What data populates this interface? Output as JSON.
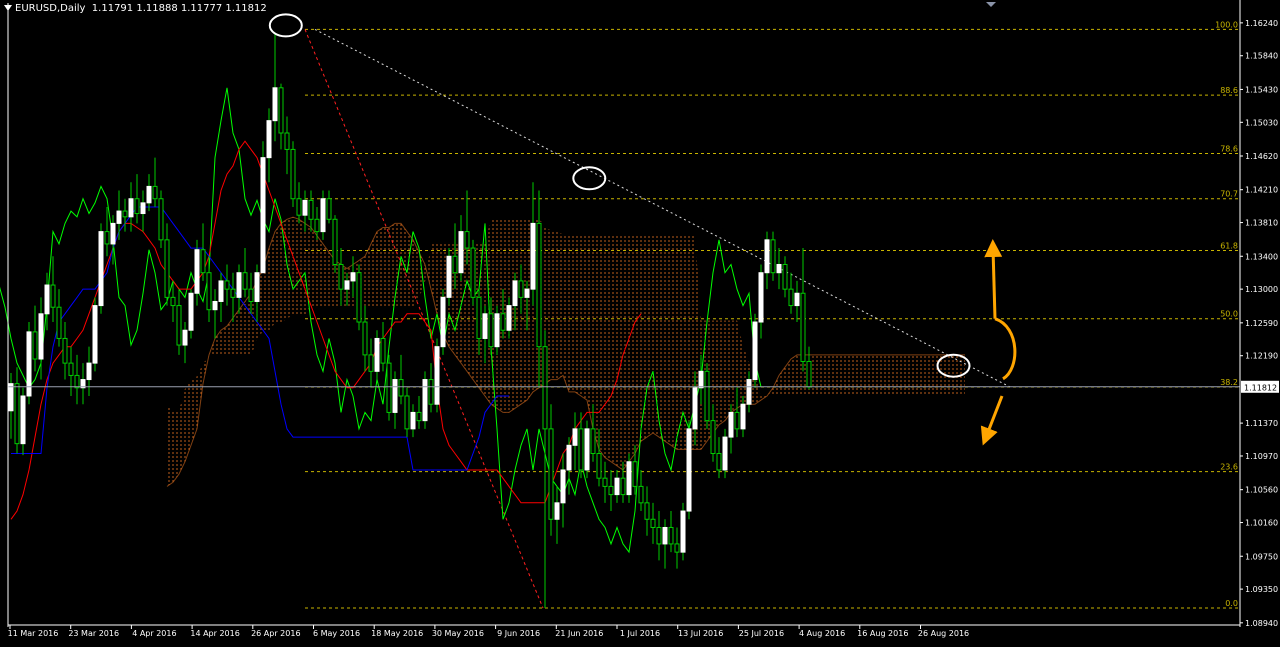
{
  "header": {
    "symbol": "EURUSD,Daily",
    "quote": "1.11791 1.11888 1.11777 1.11812"
  },
  "colors": {
    "background": "#000000",
    "axis": "#ffffff",
    "bull": "#ffffff",
    "bear": "#00cc00",
    "tenkan": "#ff0000",
    "kijun": "#0000ff",
    "chikou": "#00ff00",
    "cloud": "#d2691e",
    "fib": "#c8b400",
    "annotation": "#ffa500"
  },
  "chart_data": {
    "type": "candlestick",
    "ylim": [
      1.0895,
      1.1636
    ],
    "price_axis_ticks": [
      "1.16240",
      "1.15840",
      "1.15430",
      "1.15030",
      "1.14620",
      "1.14210",
      "1.13810",
      "1.13400",
      "1.13000",
      "1.12590",
      "1.12190",
      "1.11812",
      "1.11370",
      "1.10970",
      "1.10560",
      "1.10160",
      "1.09750",
      "1.09350",
      "1.08940"
    ],
    "current_price": 1.11812,
    "date_labels": [
      "11 Mar 2016",
      "23 Mar 2016",
      "4 Apr 2016",
      "14 Apr 2016",
      "26 Apr 2016",
      "6 May 2016",
      "18 May 2016",
      "30 May 2016",
      "9 Jun 2016",
      "21 Jun 2016",
      "1 Jul 2016",
      "13 Jul 2016",
      "25 Jul 2016",
      "4 Aug 2016",
      "16 Aug 2016",
      "26 Aug 2016"
    ],
    "fibonacci": {
      "high": 1.1616,
      "low": 1.0912,
      "levels": [
        {
          "label": "100.0",
          "value": 1.1616
        },
        {
          "label": "88.6",
          "value": 1.1536
        },
        {
          "label": "78.6",
          "value": 1.1465
        },
        {
          "label": "70.7",
          "value": 1.141
        },
        {
          "label": "61.8",
          "value": 1.1347
        },
        {
          "label": "50.0",
          "value": 1.1264
        },
        {
          "label": "38.2",
          "value": 1.1181
        },
        {
          "label": "23.6",
          "value": 1.1078
        },
        {
          "label": "0.0",
          "value": 1.0912
        }
      ]
    },
    "candles": [
      [
        1.1152,
        1.1198,
        1.1118,
        1.1185
      ],
      [
        1.1185,
        1.1205,
        1.11,
        1.1112
      ],
      [
        1.1112,
        1.118,
        1.1098,
        1.117
      ],
      [
        1.117,
        1.126,
        1.116,
        1.1248
      ],
      [
        1.1248,
        1.128,
        1.12,
        1.1215
      ],
      [
        1.1215,
        1.129,
        1.119,
        1.127
      ],
      [
        1.127,
        1.132,
        1.125,
        1.1305
      ],
      [
        1.1305,
        1.134,
        1.126,
        1.1278
      ],
      [
        1.1278,
        1.13,
        1.123,
        1.124
      ],
      [
        1.124,
        1.126,
        1.119,
        1.121
      ],
      [
        1.121,
        1.123,
        1.117,
        1.1195
      ],
      [
        1.1195,
        1.122,
        1.116,
        1.118
      ],
      [
        1.118,
        1.121,
        1.116,
        1.119
      ],
      [
        1.119,
        1.123,
        1.117,
        1.121
      ],
      [
        1.121,
        1.129,
        1.12,
        1.128
      ],
      [
        1.128,
        1.138,
        1.127,
        1.137
      ],
      [
        1.137,
        1.14,
        1.134,
        1.1355
      ],
      [
        1.1355,
        1.139,
        1.133,
        1.138
      ],
      [
        1.138,
        1.142,
        1.136,
        1.1395
      ],
      [
        1.1395,
        1.141,
        1.137,
        1.1388
      ],
      [
        1.1388,
        1.143,
        1.137,
        1.141
      ],
      [
        1.141,
        1.144,
        1.138,
        1.1392
      ],
      [
        1.1392,
        1.142,
        1.137,
        1.1405
      ],
      [
        1.1405,
        1.144,
        1.1395,
        1.1425
      ],
      [
        1.1425,
        1.146,
        1.14,
        1.141
      ],
      [
        1.141,
        1.142,
        1.135,
        1.136
      ],
      [
        1.136,
        1.138,
        1.128,
        1.129
      ],
      [
        1.129,
        1.131,
        1.126,
        1.128
      ],
      [
        1.128,
        1.13,
        1.122,
        1.1232
      ],
      [
        1.1232,
        1.126,
        1.121,
        1.125
      ],
      [
        1.125,
        1.13,
        1.124,
        1.1295
      ],
      [
        1.1295,
        1.136,
        1.128,
        1.1348
      ],
      [
        1.1348,
        1.138,
        1.131,
        1.132
      ],
      [
        1.132,
        1.134,
        1.126,
        1.1275
      ],
      [
        1.1275,
        1.13,
        1.124,
        1.1285
      ],
      [
        1.1285,
        1.132,
        1.126,
        1.131
      ],
      [
        1.131,
        1.133,
        1.128,
        1.13
      ],
      [
        1.13,
        1.132,
        1.126,
        1.129
      ],
      [
        1.129,
        1.133,
        1.127,
        1.132
      ],
      [
        1.132,
        1.135,
        1.129,
        1.13
      ],
      [
        1.13,
        1.132,
        1.127,
        1.1285
      ],
      [
        1.1285,
        1.133,
        1.126,
        1.132
      ],
      [
        1.132,
        1.148,
        1.132,
        1.146
      ],
      [
        1.146,
        1.152,
        1.143,
        1.1505
      ],
      [
        1.1505,
        1.1612,
        1.148,
        1.1545
      ],
      [
        1.1545,
        1.155,
        1.147,
        1.149
      ],
      [
        1.149,
        1.151,
        1.144,
        1.147
      ],
      [
        1.147,
        1.148,
        1.14,
        1.141
      ],
      [
        1.141,
        1.143,
        1.138,
        1.139
      ],
      [
        1.139,
        1.142,
        1.137,
        1.1408
      ],
      [
        1.1408,
        1.142,
        1.137,
        1.1385
      ],
      [
        1.1385,
        1.14,
        1.136,
        1.137
      ],
      [
        1.137,
        1.142,
        1.136,
        1.141
      ],
      [
        1.141,
        1.142,
        1.138,
        1.1385
      ],
      [
        1.1385,
        1.139,
        1.132,
        1.133
      ],
      [
        1.133,
        1.135,
        1.128,
        1.13
      ],
      [
        1.13,
        1.132,
        1.128,
        1.131
      ],
      [
        1.131,
        1.134,
        1.129,
        1.132
      ],
      [
        1.132,
        1.133,
        1.125,
        1.126
      ],
      [
        1.126,
        1.128,
        1.12,
        1.122
      ],
      [
        1.122,
        1.124,
        1.118,
        1.12
      ],
      [
        1.12,
        1.125,
        1.119,
        1.124
      ],
      [
        1.124,
        1.126,
        1.12,
        1.121
      ],
      [
        1.121,
        1.122,
        1.114,
        1.115
      ],
      [
        1.115,
        1.12,
        1.113,
        1.119
      ],
      [
        1.119,
        1.122,
        1.116,
        1.117
      ],
      [
        1.117,
        1.118,
        1.112,
        1.113
      ],
      [
        1.113,
        1.116,
        1.112,
        1.115
      ],
      [
        1.115,
        1.117,
        1.113,
        1.114
      ],
      [
        1.114,
        1.12,
        1.113,
        1.119
      ],
      [
        1.119,
        1.121,
        1.115,
        1.116
      ],
      [
        1.116,
        1.124,
        1.115,
        1.123
      ],
      [
        1.123,
        1.13,
        1.122,
        1.129
      ],
      [
        1.129,
        1.135,
        1.128,
        1.134
      ],
      [
        1.134,
        1.138,
        1.13,
        1.132
      ],
      [
        1.132,
        1.139,
        1.131,
        1.137
      ],
      [
        1.137,
        1.142,
        1.133,
        1.135
      ],
      [
        1.135,
        1.136,
        1.128,
        1.129
      ],
      [
        1.129,
        1.13,
        1.122,
        1.124
      ],
      [
        1.124,
        1.128,
        1.121,
        1.127
      ],
      [
        1.127,
        1.129,
        1.122,
        1.123
      ],
      [
        1.123,
        1.128,
        1.122,
        1.127
      ],
      [
        1.127,
        1.13,
        1.124,
        1.125
      ],
      [
        1.125,
        1.129,
        1.124,
        1.128
      ],
      [
        1.128,
        1.132,
        1.125,
        1.131
      ],
      [
        1.131,
        1.133,
        1.127,
        1.129
      ],
      [
        1.129,
        1.131,
        1.125,
        1.13
      ],
      [
        1.13,
        1.143,
        1.128,
        1.138
      ],
      [
        1.138,
        1.142,
        1.118,
        1.123
      ],
      [
        1.123,
        1.125,
        1.0912,
        1.113
      ],
      [
        1.113,
        1.116,
        1.1,
        1.102
      ],
      [
        1.102,
        1.106,
        1.099,
        1.104
      ],
      [
        1.104,
        1.11,
        1.101,
        1.108
      ],
      [
        1.108,
        1.112,
        1.105,
        1.111
      ],
      [
        1.111,
        1.115,
        1.108,
        1.113
      ],
      [
        1.113,
        1.115,
        1.107,
        1.108
      ],
      [
        1.108,
        1.114,
        1.107,
        1.113
      ],
      [
        1.113,
        1.116,
        1.109,
        1.11
      ],
      [
        1.11,
        1.113,
        1.106,
        1.107
      ],
      [
        1.107,
        1.109,
        1.104,
        1.106
      ],
      [
        1.106,
        1.108,
        1.103,
        1.105
      ],
      [
        1.105,
        1.108,
        1.104,
        1.107
      ],
      [
        1.107,
        1.109,
        1.104,
        1.105
      ],
      [
        1.105,
        1.11,
        1.104,
        1.109
      ],
      [
        1.109,
        1.111,
        1.105,
        1.106
      ],
      [
        1.106,
        1.108,
        1.103,
        1.104
      ],
      [
        1.104,
        1.106,
        1.1,
        1.102
      ],
      [
        1.102,
        1.104,
        1.099,
        1.101
      ],
      [
        1.101,
        1.103,
        1.097,
        1.099
      ],
      [
        1.099,
        1.102,
        1.096,
        1.101
      ],
      [
        1.101,
        1.103,
        1.098,
        1.099
      ],
      [
        1.099,
        1.101,
        1.096,
        1.098
      ],
      [
        1.098,
        1.104,
        1.097,
        1.103
      ],
      [
        1.103,
        1.114,
        1.102,
        1.113
      ],
      [
        1.113,
        1.12,
        1.111,
        1.118
      ],
      [
        1.118,
        1.122,
        1.116,
        1.12
      ],
      [
        1.12,
        1.121,
        1.113,
        1.114
      ],
      [
        1.114,
        1.116,
        1.109,
        1.11
      ],
      [
        1.11,
        1.112,
        1.107,
        1.108
      ],
      [
        1.108,
        1.113,
        1.107,
        1.112
      ],
      [
        1.112,
        1.116,
        1.11,
        1.115
      ],
      [
        1.115,
        1.118,
        1.112,
        1.113
      ],
      [
        1.113,
        1.117,
        1.112,
        1.116
      ],
      [
        1.116,
        1.12,
        1.115,
        1.119
      ],
      [
        1.119,
        1.127,
        1.118,
        1.126
      ],
      [
        1.126,
        1.133,
        1.124,
        1.132
      ],
      [
        1.132,
        1.137,
        1.13,
        1.136
      ],
      [
        1.136,
        1.137,
        1.131,
        1.132
      ],
      [
        1.132,
        1.135,
        1.13,
        1.133
      ],
      [
        1.133,
        1.134,
        1.129,
        1.13
      ],
      [
        1.13,
        1.132,
        1.127,
        1.128
      ],
      [
        1.128,
        1.131,
        1.126,
        1.1295
      ],
      [
        1.1295,
        1.135,
        1.12,
        1.1212
      ],
      [
        1.1212,
        1.123,
        1.1178,
        1.1181
      ]
    ],
    "tenkan_sen": [
      1.102,
      1.103,
      1.105,
      1.108,
      1.112,
      1.116,
      1.119,
      1.121,
      1.122,
      1.123,
      1.123,
      1.124,
      1.125,
      1.127,
      1.129,
      1.131,
      1.133,
      1.135,
      1.137,
      1.138,
      1.138,
      1.1375,
      1.137,
      1.136,
      1.135,
      1.133,
      1.132,
      1.131,
      1.13,
      1.13,
      1.13,
      1.131,
      1.132,
      1.134,
      1.138,
      1.142,
      1.144,
      1.145,
      1.147,
      1.148,
      1.147,
      1.146,
      1.144,
      1.142,
      1.14,
      1.138,
      1.136,
      1.134,
      1.132,
      1.13,
      1.128,
      1.126,
      1.124,
      1.122,
      1.12,
      1.119,
      1.118,
      1.118,
      1.119,
      1.12,
      1.121,
      1.123,
      1.124,
      1.125,
      1.126,
      1.126,
      1.127,
      1.127,
      1.127,
      1.126,
      1.125,
      1.118,
      1.113,
      1.111,
      1.11,
      1.109,
      1.108,
      1.108,
      1.108,
      1.108,
      1.108,
      1.108,
      1.107,
      1.106,
      1.105,
      1.104,
      1.104,
      1.104,
      1.104,
      1.104,
      1.106,
      1.108,
      1.11,
      1.111,
      1.113,
      1.114,
      1.115,
      1.115,
      1.115,
      1.116,
      1.117,
      1.119,
      1.122,
      1.124,
      1.126,
      1.127
    ],
    "kijun_sen": [
      1.11,
      1.11,
      1.11,
      1.11,
      1.11,
      1.11,
      1.118,
      1.123,
      1.126,
      1.127,
      1.128,
      1.129,
      1.13,
      1.13,
      1.13,
      1.131,
      1.132,
      1.135,
      1.137,
      1.138,
      1.139,
      1.14,
      1.14,
      1.14,
      1.14,
      1.14,
      1.139,
      1.138,
      1.137,
      1.136,
      1.135,
      1.135,
      1.135,
      1.134,
      1.133,
      1.132,
      1.131,
      1.13,
      1.129,
      1.128,
      1.127,
      1.126,
      1.125,
      1.124,
      1.12,
      1.116,
      1.113,
      1.112,
      1.112,
      1.112,
      1.112,
      1.112,
      1.112,
      1.112,
      1.112,
      1.112,
      1.112,
      1.112,
      1.112,
      1.112,
      1.112,
      1.112,
      1.112,
      1.112,
      1.112,
      1.112,
      1.112,
      1.108,
      1.108,
      1.108,
      1.108,
      1.108,
      1.108,
      1.108,
      1.108,
      1.108,
      1.108,
      1.11,
      1.112,
      1.115,
      1.116,
      1.117,
      1.117,
      1.117
    ],
    "annotations": {
      "circled_points": [
        {
          "x": "26 Apr 2016",
          "y": 1.1616
        },
        {
          "x": "21 Jun 2016",
          "y": 1.143
        },
        {
          "x": "26 Aug 2016",
          "y": 1.1202
        }
      ],
      "arrow_targets": {
        "up": 1.135,
        "down": 1.112
      }
    }
  }
}
